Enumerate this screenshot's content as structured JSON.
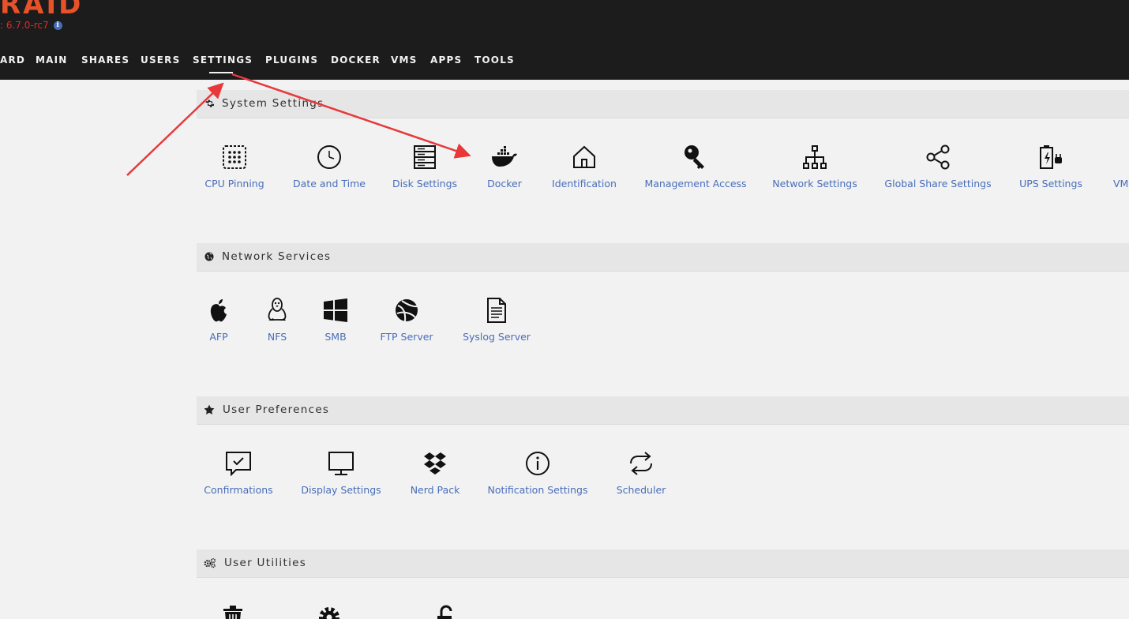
{
  "brand": {
    "logo_text": "RAID",
    "version": ": 6.7.0-rc7",
    "info_icon": "info-icon"
  },
  "nav": {
    "items": [
      {
        "label": "ARD",
        "name": "nav-dashboard"
      },
      {
        "label": "MAIN",
        "name": "nav-main"
      },
      {
        "label": "SHARES",
        "name": "nav-shares"
      },
      {
        "label": "USERS",
        "name": "nav-users"
      },
      {
        "label": "SETTINGS",
        "name": "nav-settings",
        "active": true
      },
      {
        "label": "PLUGINS",
        "name": "nav-plugins"
      },
      {
        "label": "DOCKER",
        "name": "nav-docker"
      },
      {
        "label": "VMS",
        "name": "nav-vms"
      },
      {
        "label": "APPS",
        "name": "nav-apps"
      },
      {
        "label": "TOOLS",
        "name": "nav-tools"
      }
    ]
  },
  "sections": {
    "system": {
      "title": "System Settings",
      "icon": "gear-icon",
      "items": [
        {
          "label": "CPU Pinning",
          "icon": "cpu-pinning-icon"
        },
        {
          "label": "Date and Time",
          "icon": "clock-icon"
        },
        {
          "label": "Disk Settings",
          "icon": "disk-stack-icon"
        },
        {
          "label": "Docker",
          "icon": "docker-whale-icon"
        },
        {
          "label": "Identification",
          "icon": "home-icon"
        },
        {
          "label": "Management Access",
          "icon": "key-icon"
        },
        {
          "label": "Network Settings",
          "icon": "network-tree-icon"
        },
        {
          "label": "Global Share Settings",
          "icon": "share-icon"
        },
        {
          "label": "UPS Settings",
          "icon": "battery-plug-icon"
        },
        {
          "label": "VM",
          "icon": "vm-icon"
        }
      ]
    },
    "network": {
      "title": "Network Services",
      "icon": "globe-icon",
      "items": [
        {
          "label": "AFP",
          "icon": "apple-icon"
        },
        {
          "label": "NFS",
          "icon": "linux-tux-icon"
        },
        {
          "label": "SMB",
          "icon": "windows-icon"
        },
        {
          "label": "FTP Server",
          "icon": "ftp-globe-icon"
        },
        {
          "label": "Syslog Server",
          "icon": "document-icon"
        }
      ]
    },
    "prefs": {
      "title": "User Preferences",
      "icon": "star-icon",
      "items": [
        {
          "label": "Confirmations",
          "icon": "confirm-bubble-icon"
        },
        {
          "label": "Display Settings",
          "icon": "monitor-icon"
        },
        {
          "label": "Nerd Pack",
          "icon": "dropbox-icon"
        },
        {
          "label": "Notification Settings",
          "icon": "info-circle-icon"
        },
        {
          "label": "Scheduler",
          "icon": "refresh-cycle-icon"
        }
      ]
    },
    "utilities": {
      "title": "User Utilities",
      "icon": "gears-icon",
      "items": [
        {
          "label": "",
          "icon": "trash-icon"
        },
        {
          "label": "",
          "icon": "cog-icon"
        },
        {
          "label": "",
          "icon": "unlock-icon"
        }
      ]
    }
  },
  "colors": {
    "header_bg": "#1c1c1c",
    "logo": "#e8522a",
    "link": "#486dba",
    "annotation_arrow": "#e8383a"
  }
}
